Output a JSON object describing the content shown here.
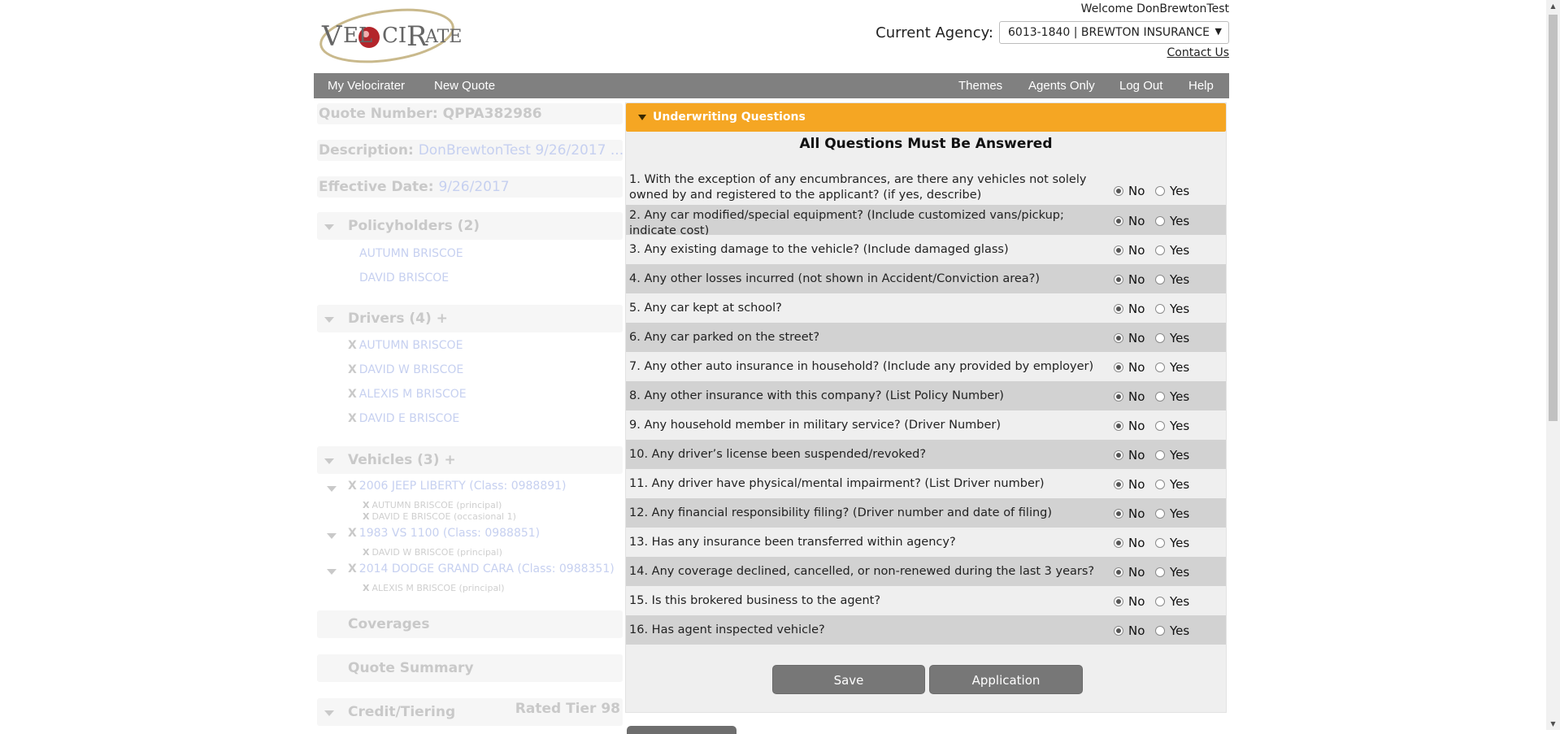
{
  "header": {
    "logo_text": "VELOCIRATER",
    "welcome": "Welcome DonBrewtonTest",
    "agency_label": "Current Agency:",
    "agency_value": "6013-1840 | BREWTON INSURANCE",
    "contact": "Contact Us"
  },
  "nav": {
    "left": [
      "My Velocirater",
      "New Quote"
    ],
    "right": [
      "Themes",
      "Agents Only",
      "Log Out",
      "Help"
    ]
  },
  "sidebar": {
    "quote_number_label": "Quote Number:",
    "quote_number": "QPPA382986",
    "description_label": "Description:",
    "description": "DonBrewtonTest 9/26/2017 ...",
    "effective_label": "Effective Date:",
    "effective": "9/26/2017",
    "policyholders_title": "Policyholders (2)",
    "policyholders": [
      "AUTUMN BRISCOE",
      "DAVID BRISCOE"
    ],
    "drivers_title": "Drivers (4) +",
    "drivers": [
      "AUTUMN BRISCOE",
      "DAVID W BRISCOE",
      "ALEXIS M BRISCOE",
      "DAVID E BRISCOE"
    ],
    "vehicles_title": "Vehicles (3) +",
    "vehicles": [
      {
        "name": "2006 JEEP LIBERTY (Class: 0988891)",
        "drivers": [
          "AUTUMN BRISCOE (principal)",
          "DAVID E BRISCOE (occasional 1)"
        ]
      },
      {
        "name": "1983 VS 1100 (Class: 0988851)",
        "drivers": [
          "DAVID W BRISCOE (principal)"
        ]
      },
      {
        "name": "2014 DODGE GRAND CARA (Class: 0988351)",
        "drivers": [
          "ALEXIS M BRISCOE (principal)"
        ]
      }
    ],
    "x_mark": "X",
    "coverages": "Coverages",
    "quote_summary": "Quote Summary",
    "credit": "Credit/Tiering",
    "rated_tier": "Rated Tier 98"
  },
  "underwriting": {
    "title": "Underwriting Questions",
    "subtitle": "All Questions Must Be Answered",
    "no_label": "No",
    "yes_label": "Yes",
    "questions": [
      {
        "text": "1. With the exception of any encumbrances, are there any vehicles not solely owned by and registered to the applicant? (if yes, describe)",
        "answer": "No"
      },
      {
        "text": "2. Any car modified/special equipment? (Include customized vans/pickup; indicate cost)",
        "answer": "No"
      },
      {
        "text": "3. Any existing damage to the vehicle? (Include damaged glass)",
        "answer": "No"
      },
      {
        "text": "4. Any other losses incurred (not shown in Accident/Conviction area?)",
        "answer": "No"
      },
      {
        "text": "5. Any car kept at school?",
        "answer": "No"
      },
      {
        "text": "6. Any car parked on the street?",
        "answer": "No"
      },
      {
        "text": "7. Any other auto insurance in household? (Include any provided by employer)",
        "answer": "No"
      },
      {
        "text": "8. Any other insurance with this company? (List Policy Number)",
        "answer": "No"
      },
      {
        "text": "9. Any household member in military service? (Driver Number)",
        "answer": "No"
      },
      {
        "text": "10. Any driver’s license been suspended/revoked?",
        "answer": "No"
      },
      {
        "text": "11. Any driver have physical/mental impairment? (List Driver number)",
        "answer": "No"
      },
      {
        "text": "12. Any financial responsibility filing? (Driver number and date of filing)",
        "answer": "No"
      },
      {
        "text": "13. Has any insurance been transferred within agency?",
        "answer": "No"
      },
      {
        "text": "14. Any coverage declined, cancelled, or non-renewed during the last 3 years?",
        "answer": "No"
      },
      {
        "text": "15. Is this brokered business to the agent?",
        "answer": "No"
      },
      {
        "text": "16. Has agent inspected vehicle?",
        "answer": "No"
      }
    ],
    "save": "Save",
    "application": "Application"
  }
}
